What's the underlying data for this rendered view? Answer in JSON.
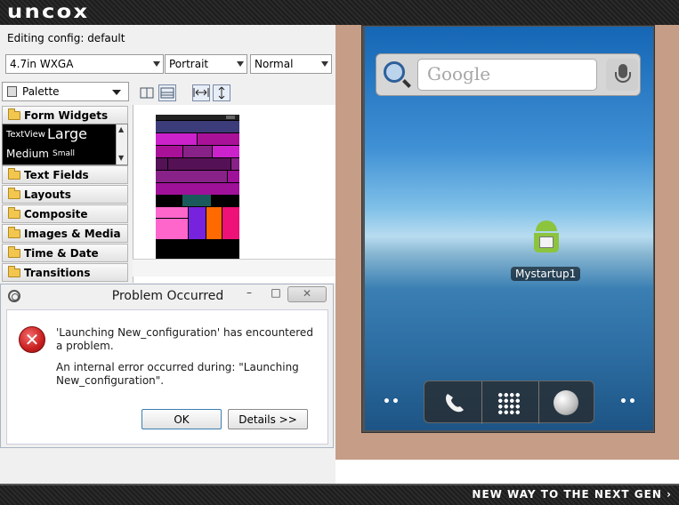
{
  "banner": {
    "logo": "uncox",
    "tagline": "NEW WAY TO THE NEXT GEN ›"
  },
  "editor": {
    "config_label": "Editing config:  default",
    "device": "4.7in WXGA",
    "orientation": "Portrait",
    "theme": "Normal",
    "palette": {
      "title": "Palette",
      "open_category": "Form Widgets",
      "widgets": {
        "textview": "TextView",
        "large": "Large",
        "medium": "Medium",
        "small": "Small"
      },
      "categories": [
        "Text Fields",
        "Layouts",
        "Composite",
        "Images & Media",
        "Time & Date",
        "Transitions"
      ]
    }
  },
  "dialog": {
    "title": "Problem Occurred",
    "controls": {
      "minimize": "–",
      "maximize": "□",
      "close": "✕"
    },
    "message1": "'Launching New_configuration' has encountered a problem.",
    "message2": "An internal error occurred during: \"Launching New_configuration\".",
    "ok_label": "OK",
    "details_label": "Details >>"
  },
  "emulator": {
    "search_placeholder": "Google",
    "app_name": "Mystartup1",
    "dots_left": "••",
    "dots_right": "••"
  },
  "colors": {
    "error_red": "#c91f1f",
    "android_green": "#8cc43e",
    "emulator_bezel": "#c69d86",
    "mini_layout_blocks": [
      "#3c3c7a",
      "#cc22cc",
      "#aa1199",
      "#882288",
      "#551155",
      "#a0119a",
      "#1a5a5a",
      "#ff66cc",
      "#7722dd",
      "#ff6a00",
      "#ee1177"
    ]
  }
}
